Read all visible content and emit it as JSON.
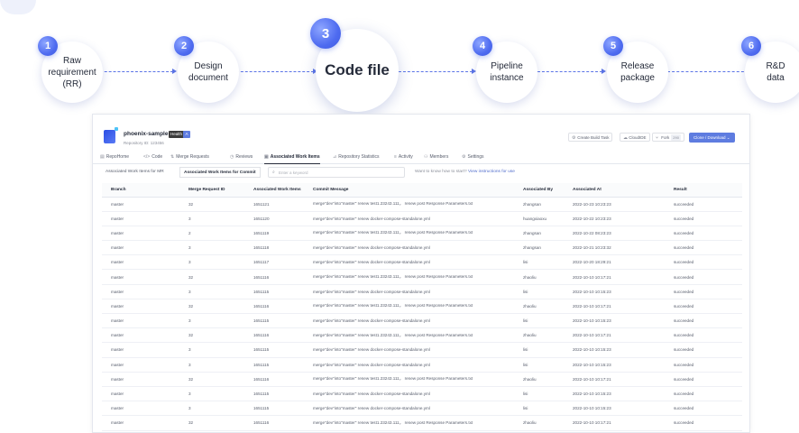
{
  "flow": {
    "steps": [
      {
        "number": "1",
        "label": "Raw\nrequirement\n(RR)"
      },
      {
        "number": "2",
        "label": "Design\ndocument"
      },
      {
        "number": "3",
        "label": "Code file"
      },
      {
        "number": "4",
        "label": "Pipeline\ninstance"
      },
      {
        "number": "5",
        "label": "Release\npackage"
      },
      {
        "number": "6",
        "label": "R&D\ndata"
      }
    ],
    "accent_color": "#4e6bf0"
  },
  "repo": {
    "name": "phoenix-sample",
    "health_label": "Health",
    "health_score": "A",
    "repository_id": "Repository ID: 123456",
    "actions": {
      "create_build_task": "Create Build Task",
      "cloudide": "CloudIDE",
      "fork": "Fork",
      "fork_count": "290",
      "clone_download": "Clone / Download"
    }
  },
  "nav": {
    "tabs": [
      {
        "icon": "repo-icon",
        "label": "RepoHome"
      },
      {
        "icon": "code-icon",
        "label": "Code"
      },
      {
        "icon": "merge-icon",
        "label": "Merge Requests"
      },
      {
        "icon": "review-icon",
        "label": "Reviews"
      },
      {
        "icon": "work-items-icon",
        "label": "Associated Work Items"
      },
      {
        "icon": "stats-icon",
        "label": "Repository Statistics"
      },
      {
        "icon": "activity-icon",
        "label": "Activity"
      },
      {
        "icon": "members-icon",
        "label": "Members"
      },
      {
        "icon": "settings-icon",
        "label": "Settings"
      }
    ],
    "active_tab": "Associated Work Items"
  },
  "subtabs": {
    "items": [
      "Associated Work Items for MR",
      "Associated Work Items for Commit"
    ],
    "active": "Associated Work Items for Commit"
  },
  "search": {
    "placeholder": "Enter a keyword"
  },
  "help": {
    "text": "Want to know how to start?",
    "link": "View instructions for use"
  },
  "table": {
    "headers": [
      "Branch",
      "Merge Request ID",
      "Associated Work Items",
      "Commit Message",
      "Associated By",
      "Associated At",
      "Result"
    ],
    "rows": [
      [
        "master",
        "32",
        "1651121",
        "merge\"dev\"into\"master\" renew test1.23243.111， renew post Response Parameters.txt",
        "zhangsan",
        "2022-10-23 10:23:23",
        "succeeded"
      ],
      [
        "master",
        "3",
        "1651120",
        "merge\"dev\"into\"master\" renew docker-compose-standalone.yml",
        "huangxiaoxu",
        "2022-10-22 10:23:23",
        "succeeded"
      ],
      [
        "master",
        "2",
        "1651119",
        "merge\"dev\"into\"master\" renew test1.23243.111， renew post Response Parameters.txt",
        "zhangsan",
        "2022-10-22 08:23:23",
        "succeeded"
      ],
      [
        "master",
        "3",
        "1651118",
        "merge\"dev\"into\"master\" renew docker-compose-standalone.yml",
        "zhangsan",
        "2022-10-21 10:23:32",
        "succeeded"
      ],
      [
        "master",
        "3",
        "1651117",
        "merge\"dev\"into\"master\" renew docker-compose-standalone.yml",
        "lisi",
        "2022-10-20 18:29:21",
        "succeeded"
      ],
      [
        "master",
        "32",
        "1651116",
        "merge\"dev\"into\"master\" renew test1.23243.111， renew post Response Parameters.txt",
        "zhaoliu",
        "2022-10-10 10:17:21",
        "succeeded"
      ],
      [
        "master",
        "3",
        "1651115",
        "merge\"dev\"into\"master\" renew docker-compose-standalone.yml",
        "lisi",
        "2022-10-10 10:15:23",
        "succeeded"
      ],
      [
        "master",
        "32",
        "1651116",
        "merge\"dev\"into\"master\" renew test1.23243.111， renew post Response Parameters.txt",
        "zhaoliu",
        "2022-10-10 10:17:21",
        "succeeded"
      ],
      [
        "master",
        "3",
        "1651115",
        "merge\"dev\"into\"master\" renew docker-compose-standalone.yml",
        "lisi",
        "2022-10-10 10:15:23",
        "succeeded"
      ],
      [
        "master",
        "32",
        "1651116",
        "merge\"dev\"into\"master\" renew test1.23243.111， renew post Response Parameters.txt",
        "zhaoliu",
        "2022-10-10 10:17:21",
        "succeeded"
      ],
      [
        "master",
        "3",
        "1651115",
        "merge\"dev\"into\"master\" renew docker-compose-standalone.yml",
        "lisi",
        "2022-10-10 10:15:23",
        "succeeded"
      ],
      [
        "master",
        "3",
        "1651115",
        "merge\"dev\"into\"master\" renew docker-compose-standalone.yml",
        "lisi",
        "2022-10-10 10:15:23",
        "succeeded"
      ],
      [
        "master",
        "32",
        "1651116",
        "merge\"dev\"into\"master\" renew test1.23243.111， renew post Response Parameters.txt",
        "zhaoliu",
        "2022-10-10 10:17:21",
        "succeeded"
      ],
      [
        "master",
        "3",
        "1651115",
        "merge\"dev\"into\"master\" renew docker-compose-standalone.yml",
        "lisi",
        "2022-10-10 10:15:23",
        "succeeded"
      ],
      [
        "master",
        "3",
        "1651115",
        "merge\"dev\"into\"master\" renew docker-compose-standalone.yml",
        "lisi",
        "2022-10-10 10:15:23",
        "succeeded"
      ],
      [
        "master",
        "32",
        "1651116",
        "merge\"dev\"into\"master\" renew test1.23243.111， renew post Response Parameters.txt",
        "zhaoliu",
        "2022-10-10 10:17:21",
        "succeeded"
      ]
    ]
  }
}
